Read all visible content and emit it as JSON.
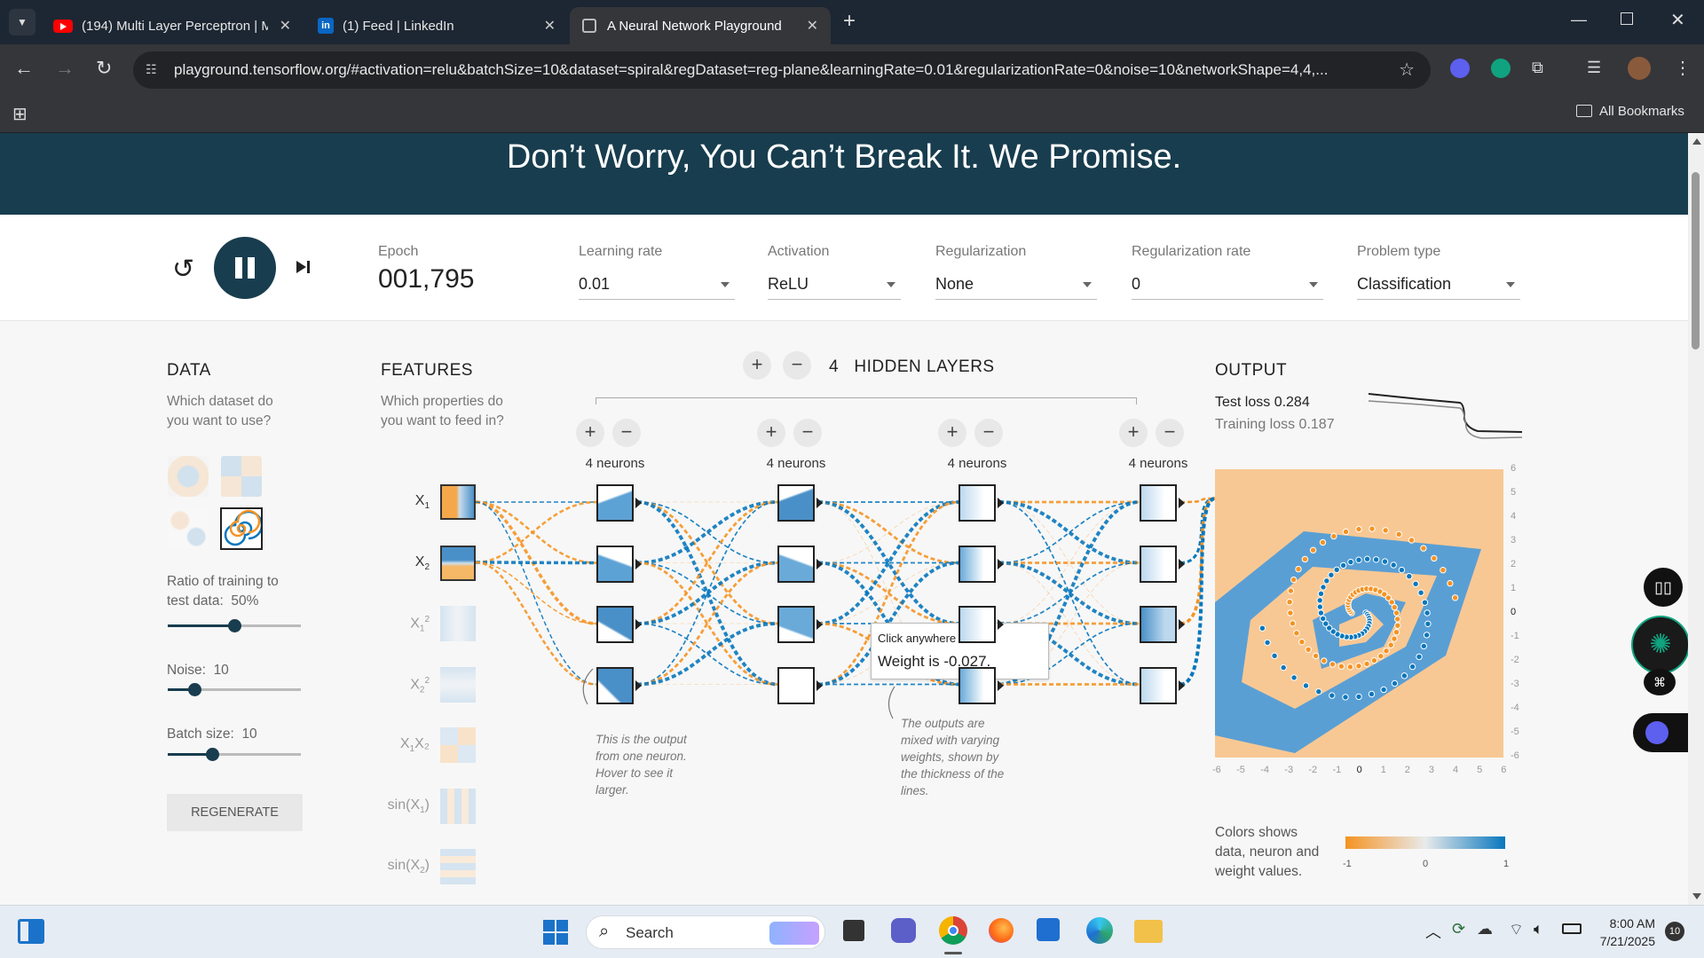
{
  "browser": {
    "tabs": [
      {
        "title": "(194) Multi Layer Perceptron | M",
        "icon": "youtube-icon"
      },
      {
        "title": "(1) Feed | LinkedIn",
        "icon": "linkedin-icon"
      },
      {
        "title": "A Neural Network Playground",
        "icon": "playground-icon"
      }
    ],
    "url": "playground.tensorflow.org/#activation=relu&batchSize=10&dataset=spiral&regDataset=reg-plane&learningRate=0.01&regularizationRate=0&noise=10&networkShape=4,4,...",
    "bookmarks_label": "All Bookmarks"
  },
  "hero": {
    "text": "Don’t Worry, You Can’t Break It. We Promise."
  },
  "controls": {
    "epoch_label": "Epoch",
    "epoch_value": "001,795",
    "learning_rate": {
      "label": "Learning rate",
      "value": "0.01"
    },
    "activation": {
      "label": "Activation",
      "value": "ReLU"
    },
    "regularization": {
      "label": "Regularization",
      "value": "None"
    },
    "regularization_rate": {
      "label": "Regularization rate",
      "value": "0"
    },
    "problem_type": {
      "label": "Problem type",
      "value": "Classification"
    }
  },
  "data_panel": {
    "title": "DATA",
    "subtitle": "Which dataset do you want to use?",
    "ratio_label": "Ratio of training to test data:",
    "ratio_value": "50%",
    "ratio_level": 0.5,
    "noise_label": "Noise:",
    "noise_value": "10",
    "noise_level": 0.2,
    "batch_label": "Batch size:",
    "batch_value": "10",
    "batch_level": 0.33,
    "regenerate": "REGENERATE"
  },
  "features_panel": {
    "title": "FEATURES",
    "subtitle": "Which properties do you want to feed in?",
    "features": [
      {
        "base": "X",
        "sub": "1",
        "sup": "",
        "pre": "",
        "post": "",
        "active": true
      },
      {
        "base": "X",
        "sub": "2",
        "sup": "",
        "pre": "",
        "post": "",
        "active": true
      },
      {
        "base": "X",
        "sub": "1",
        "sup": "2",
        "pre": "",
        "post": "",
        "active": false
      },
      {
        "base": "X",
        "sub": "2",
        "sup": "2",
        "pre": "",
        "post": "",
        "active": false
      },
      {
        "base": "X",
        "sub": "1",
        "sup": "",
        "pre": "",
        "post": "X₂",
        "active": false
      },
      {
        "base": "X",
        "sub": "1",
        "sup": "",
        "pre": "sin(",
        "post": ")",
        "active": false
      },
      {
        "base": "X",
        "sub": "2",
        "sup": "",
        "pre": "sin(",
        "post": ")",
        "active": false
      }
    ]
  },
  "network": {
    "hidden_layers_count": "4",
    "hidden_layers_label": "HIDDEN LAYERS",
    "layers": [
      {
        "neurons_label": "4 neurons"
      },
      {
        "neurons_label": "4 neurons"
      },
      {
        "neurons_label": "4 neurons"
      },
      {
        "neurons_label": "4 neurons"
      }
    ],
    "note_neuron": "This is the output from one neuron. Hover to see it larger.",
    "note_weights": "The outputs are mixed with varying weights, shown by the thickness of the lines.",
    "tooltip_hint": "Click anywhere to edit.",
    "tooltip_value": "Weight is -0.027."
  },
  "output_panel": {
    "title": "OUTPUT",
    "test_loss": "Test loss 0.284",
    "training_loss": "Training loss 0.187",
    "y_ticks": [
      "6",
      "5",
      "4",
      "3",
      "2",
      "1",
      "0",
      "-1",
      "-2",
      "-3",
      "-4",
      "-5",
      "-6"
    ],
    "x_ticks": [
      "-6",
      "-5",
      "-4",
      "-3",
      "-2",
      "-1",
      "0",
      "1",
      "2",
      "3",
      "4",
      "5",
      "6"
    ],
    "legend_text": "Colors shows data, neuron and weight values.",
    "legend_ticks": [
      "-1",
      "0",
      "1"
    ]
  },
  "colors": {
    "orange": "#f59322",
    "blue": "#0877bd",
    "dark": "#183d4e"
  },
  "taskbar": {
    "search": "Search",
    "time": "8:00 AM",
    "date": "7/21/2025",
    "notifications": "10"
  }
}
